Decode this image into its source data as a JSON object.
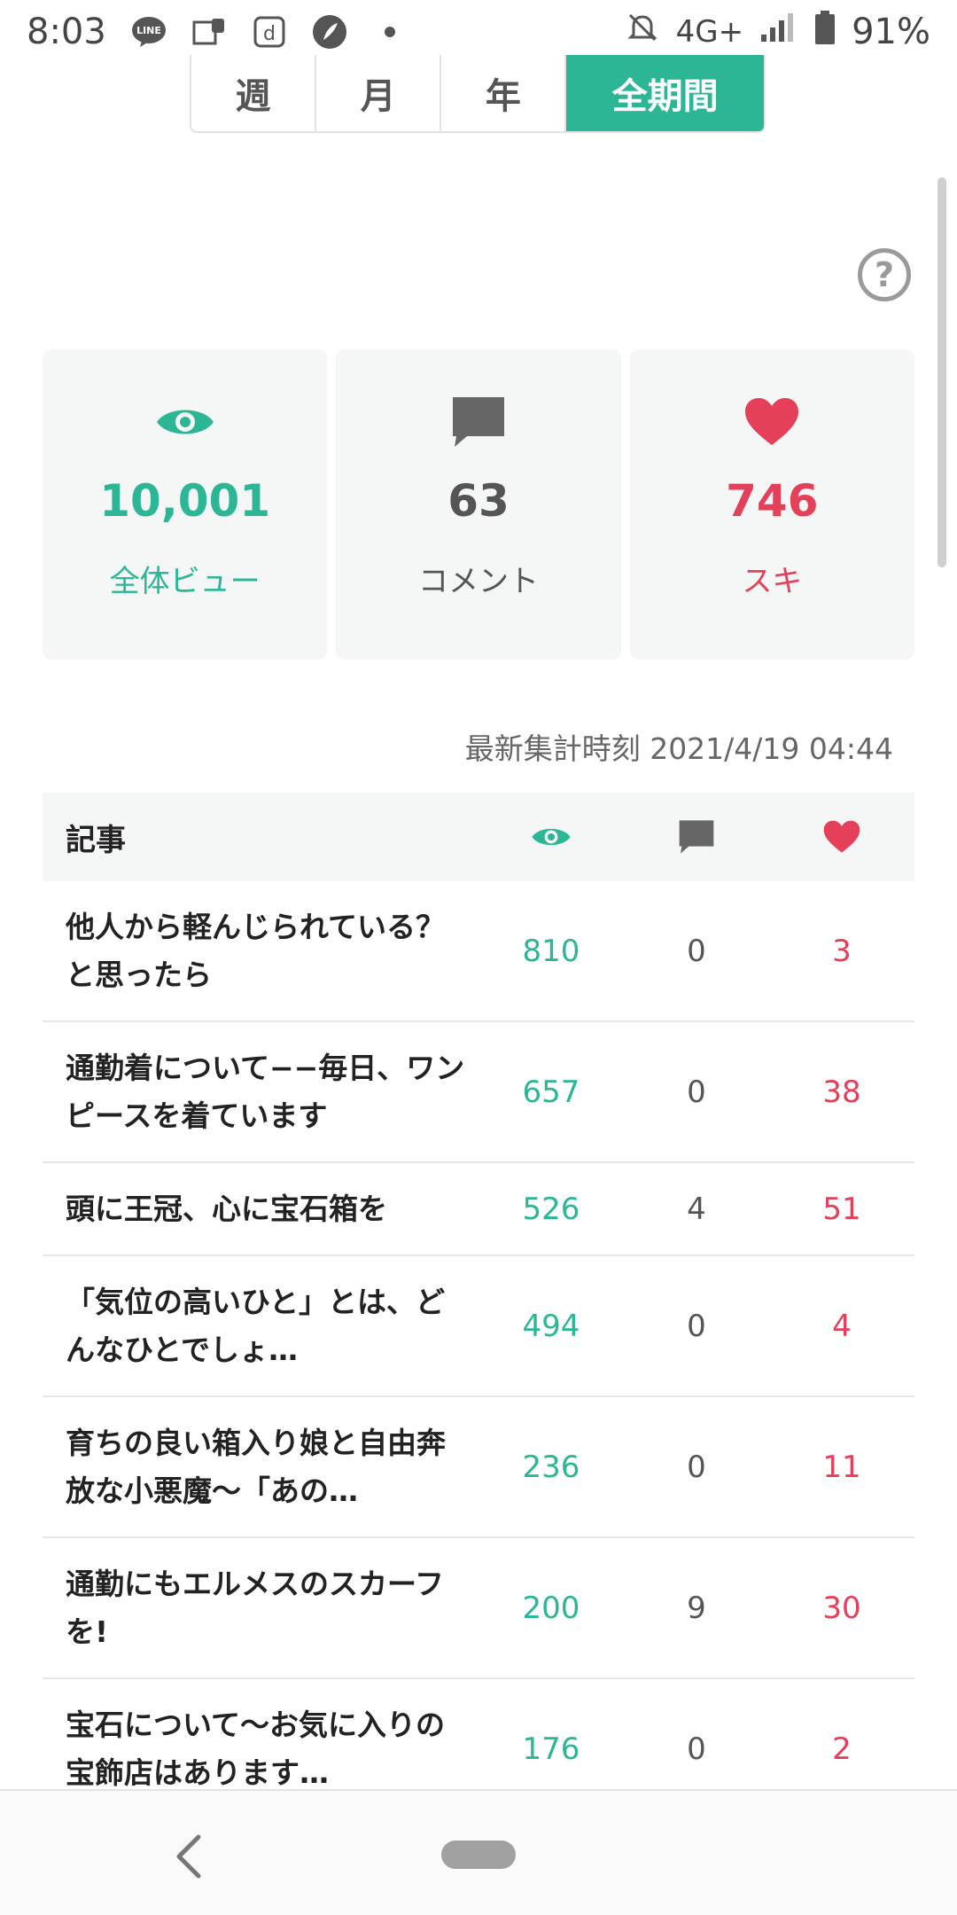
{
  "status_bar": {
    "time": "8:03",
    "network": "4G+",
    "battery": "91%",
    "icons": [
      "line-icon",
      "notification-icon",
      "d-app-icon",
      "feather-app-icon",
      "dot-icon",
      "mute-icon",
      "signal-icon",
      "battery-icon"
    ]
  },
  "period_tabs": [
    {
      "label": "週",
      "active": false
    },
    {
      "label": "月",
      "active": false
    },
    {
      "label": "年",
      "active": false
    },
    {
      "label": "全期間",
      "active": true
    }
  ],
  "help": {
    "label": "?"
  },
  "summary": {
    "views": {
      "value": "10,001",
      "label": "全体ビュー"
    },
    "comments": {
      "value": "63",
      "label": "コメント"
    },
    "likes": {
      "value": "746",
      "label": "スキ"
    }
  },
  "updated": "最新集計時刻 2021/4/19 04:44",
  "table": {
    "header_title": "記事",
    "rows": [
      {
        "title": "他人から軽んじられている？と思ったら",
        "views": "810",
        "comments": "0",
        "likes": "3"
      },
      {
        "title": "通勤着について−−毎日、ワンピースを着ています",
        "views": "657",
        "comments": "0",
        "likes": "38"
      },
      {
        "title": "頭に王冠、心に宝石箱を",
        "views": "526",
        "comments": "4",
        "likes": "51"
      },
      {
        "title": "「気位の高いひと」とは、どんなひとでしょ…",
        "views": "494",
        "comments": "0",
        "likes": "4"
      },
      {
        "title": "育ちの良い箱入り娘と自由奔放な小悪魔〜「あの…",
        "views": "236",
        "comments": "0",
        "likes": "11"
      },
      {
        "title": "通勤にもエルメスのスカーフを!",
        "views": "200",
        "comments": "9",
        "likes": "30"
      },
      {
        "title": "宝石について〜お気に入りの宝飾店はあります…",
        "views": "176",
        "comments": "0",
        "likes": "2"
      }
    ]
  },
  "colors": {
    "accent": "#2cb696",
    "like": "#e5405a",
    "comment": "#666666"
  }
}
